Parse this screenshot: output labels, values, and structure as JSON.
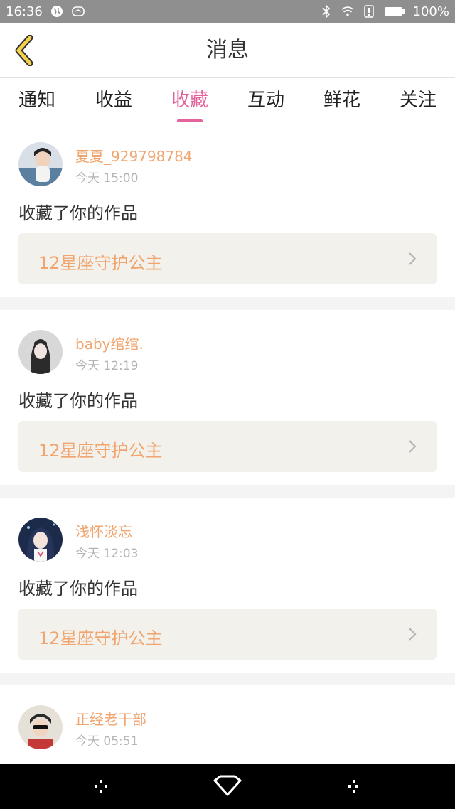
{
  "statusbar": {
    "time": "16:36",
    "battery": "100%"
  },
  "header": {
    "title": "消息"
  },
  "tabs": [
    {
      "label": "通知"
    },
    {
      "label": "收益"
    },
    {
      "label": "收藏"
    },
    {
      "label": "互动"
    },
    {
      "label": "鲜花"
    },
    {
      "label": "关注"
    }
  ],
  "activeTab": "收藏",
  "items": [
    {
      "user": "夏夏_929798784",
      "time": "今天 15:00",
      "message": "收藏了你的作品",
      "work": "12星座守护公主"
    },
    {
      "user": "baby绾绾.",
      "time": "今天 12:19",
      "message": "收藏了你的作品",
      "work": "12星座守护公主"
    },
    {
      "user": "浅怀淡忘",
      "time": "今天 12:03",
      "message": "收藏了你的作品",
      "work": "12星座守护公主"
    },
    {
      "user": "正经老干部",
      "time": "今天 05:51",
      "message": "",
      "work": ""
    }
  ],
  "colors": {
    "accent": "#e4639b",
    "username": "#f0a46e",
    "work_bg": "#f3f1ec",
    "statusbar": "#8f8f8f"
  }
}
